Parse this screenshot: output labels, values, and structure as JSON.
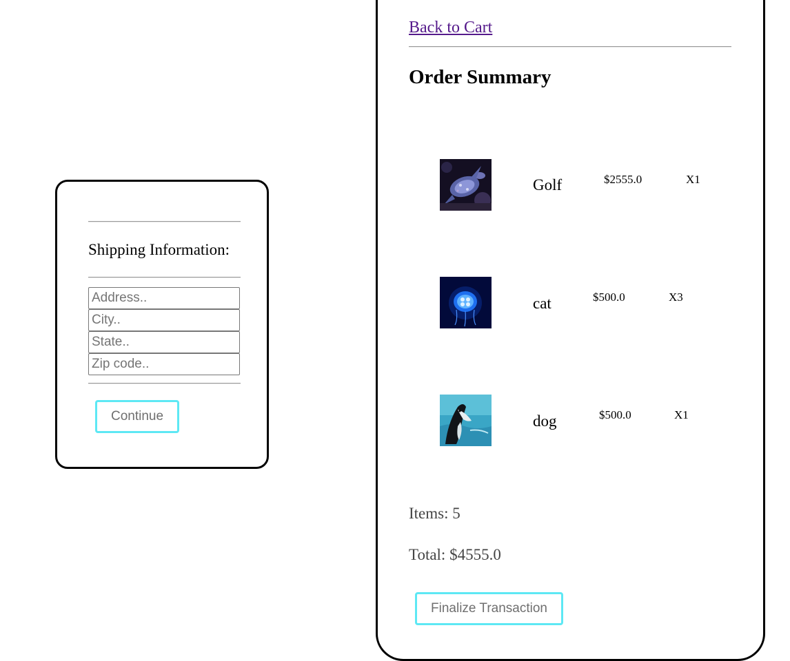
{
  "shipping": {
    "title": "Shipping Information:",
    "address_placeholder": "Address..",
    "city_placeholder": "City..",
    "state_placeholder": "State..",
    "zip_placeholder": "Zip code..",
    "continue_label": "Continue"
  },
  "order": {
    "back_link": "Back to Cart",
    "title": "Order Summary",
    "items": [
      {
        "name": "Golf",
        "price": "$2555.0",
        "qty": "X1",
        "image": "sea-turtle-image"
      },
      {
        "name": "cat",
        "price": "$500.0",
        "qty": "X3",
        "image": "jellyfish-image"
      },
      {
        "name": "dog",
        "price": "$500.0",
        "qty": "X1",
        "image": "orca-image"
      }
    ],
    "items_count": "Items: 5",
    "total": "Total: $4555.0",
    "finalize_label": "Finalize Transaction"
  },
  "colors": {
    "button_border": "#5de8f4",
    "link": "#551a8b"
  }
}
